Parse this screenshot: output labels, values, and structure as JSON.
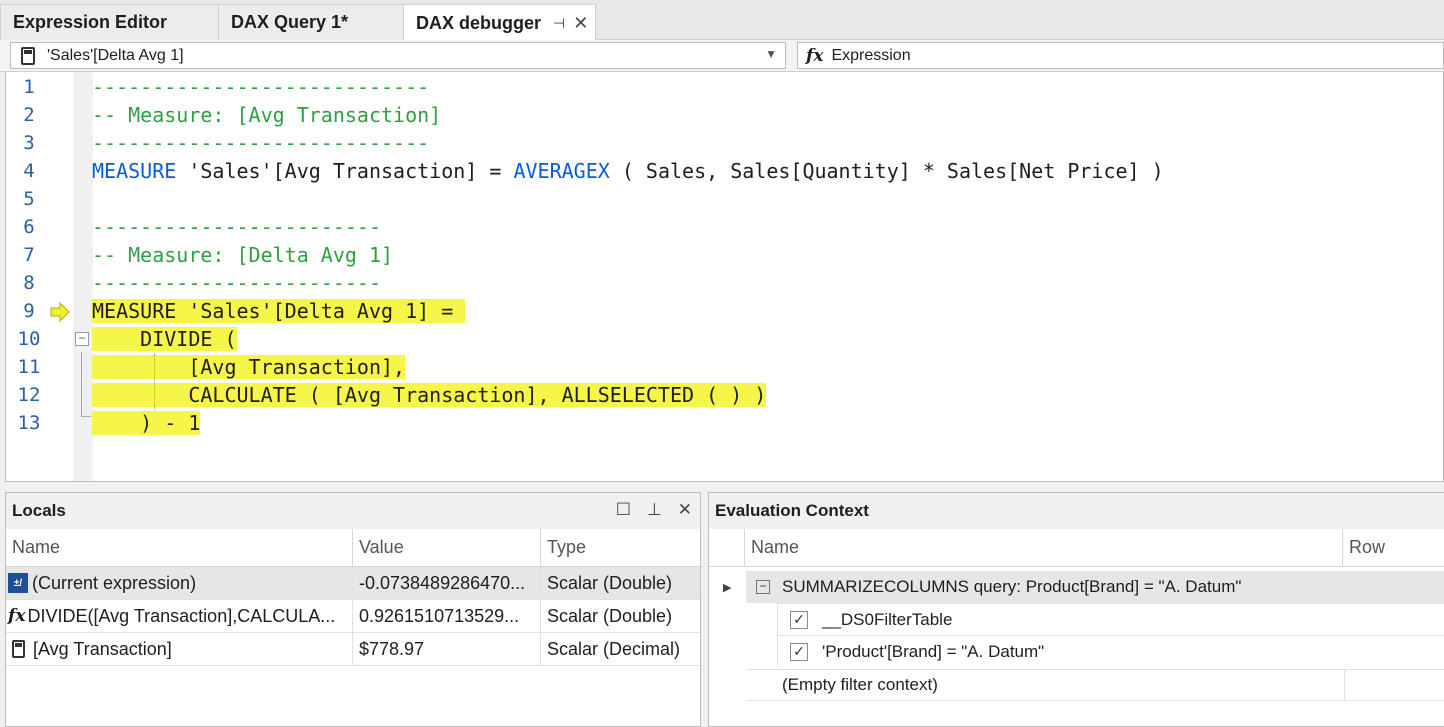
{
  "tabs": [
    {
      "label": "Expression Editor"
    },
    {
      "label": "DAX Query 1*"
    },
    {
      "label": "DAX debugger"
    }
  ],
  "toolbar": {
    "measure_selected": "'Sales'[Delta Avg 1]",
    "expression_label": "Expression"
  },
  "editor": {
    "current_line": 9,
    "lines": [
      {
        "n": "1",
        "text": "----------------------------"
      },
      {
        "n": "2",
        "text": "-- Measure: [Avg Transaction]"
      },
      {
        "n": "3",
        "text": "----------------------------"
      },
      {
        "n": "4",
        "kw1": "MEASURE",
        "mid": " 'Sales'[Avg Transaction] = ",
        "kw2": "AVERAGEX",
        "rest": " ( Sales, Sales[Quantity] * Sales[Net Price] )"
      },
      {
        "n": "5",
        "text": ""
      },
      {
        "n": "6",
        "text": "------------------------"
      },
      {
        "n": "7",
        "text": "-- Measure: [Delta Avg 1]"
      },
      {
        "n": "8",
        "text": "------------------------"
      },
      {
        "n": "9",
        "text": "MEASURE 'Sales'[Delta Avg 1] = "
      },
      {
        "n": "10",
        "text": "    DIVIDE ("
      },
      {
        "n": "11",
        "text": "        [Avg Transaction],"
      },
      {
        "n": "12",
        "text": "        CALCULATE ( [Avg Transaction], ALLSELECTED ( ) )"
      },
      {
        "n": "13",
        "text": "    ) - 1"
      }
    ]
  },
  "locals": {
    "title": "Locals",
    "columns": [
      "Name",
      "Value",
      "Type"
    ],
    "rows": [
      {
        "name": "(Current expression)",
        "value": "-0.0738489286470...",
        "type": "Scalar (Double)",
        "icon": "expression-icon"
      },
      {
        "name": "DIVIDE([Avg Transaction],CALCULA...",
        "value": "0.9261510713529...",
        "type": "Scalar (Double)",
        "icon": "fx-icon"
      },
      {
        "name": "[Avg Transaction]",
        "value": "$778.97",
        "type": "Scalar (Decimal)",
        "icon": "calculator-icon"
      }
    ]
  },
  "evaluation_context": {
    "title": "Evaluation Context",
    "columns": [
      "Name",
      "Row"
    ],
    "root": "SUMMARIZECOLUMNS query: Product[Brand] = \"A. Datum\"",
    "children": [
      "__DS0FilterTable",
      "'Product'[Brand] = \"A. Datum\""
    ],
    "empty": "(Empty filter context)"
  }
}
